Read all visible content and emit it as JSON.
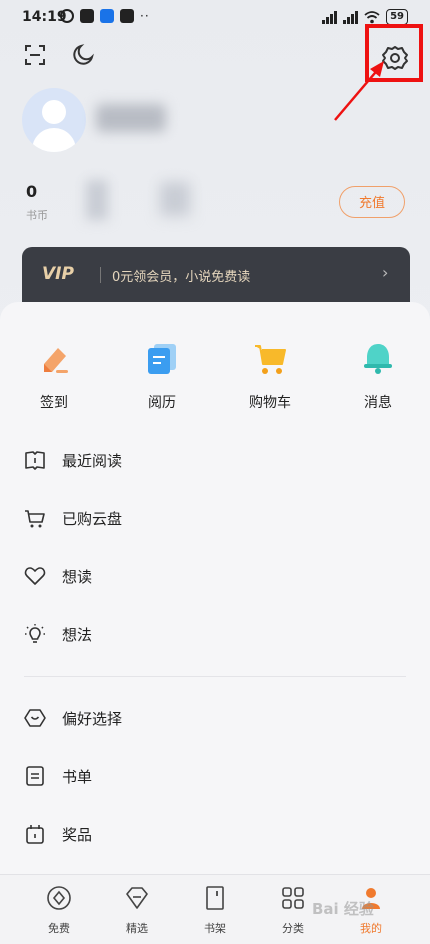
{
  "status_bar": {
    "time": "14:19",
    "more": "··",
    "battery": "59"
  },
  "header": {
    "scan_icon": "scan-icon",
    "theme_icon": "moon-icon",
    "settings_icon": "settings-gear-icon"
  },
  "wallet": {
    "coin_value": "0",
    "coin_label": "书币",
    "recharge_label": "充值"
  },
  "vip": {
    "tag": "VIP",
    "text": "0元领会员，小说免费读",
    "chevron": "›"
  },
  "shortcuts": [
    {
      "label": "签到",
      "icon": "checkin-icon"
    },
    {
      "label": "阅历",
      "icon": "history-icon"
    },
    {
      "label": "购物车",
      "icon": "cart-icon"
    },
    {
      "label": "消息",
      "icon": "bell-icon"
    }
  ],
  "menu": [
    {
      "label": "最近阅读",
      "icon": "book-icon"
    },
    {
      "label": "已购云盘",
      "icon": "cart-outline-icon"
    },
    {
      "label": "想读",
      "icon": "heart-icon"
    },
    {
      "label": "想法",
      "icon": "bulb-icon"
    },
    {
      "label": "偏好选择",
      "icon": "hexagon-icon"
    },
    {
      "label": "书单",
      "icon": "list-icon"
    },
    {
      "label": "奖品",
      "icon": "gift-icon"
    }
  ],
  "bottom_nav": [
    {
      "label": "免费",
      "icon": "free-icon"
    },
    {
      "label": "精选",
      "icon": "diamond-icon"
    },
    {
      "label": "书架",
      "icon": "bookshelf-icon"
    },
    {
      "label": "分类",
      "icon": "grid-icon"
    },
    {
      "label": "我的",
      "icon": "profile-icon",
      "active": true
    }
  ],
  "watermark": "Bai 经验",
  "colors": {
    "accent": "#f07a2e",
    "highlight": "#ee1111",
    "vip_bg": "#3a3d44",
    "vip_text": "#e5d6bd"
  }
}
